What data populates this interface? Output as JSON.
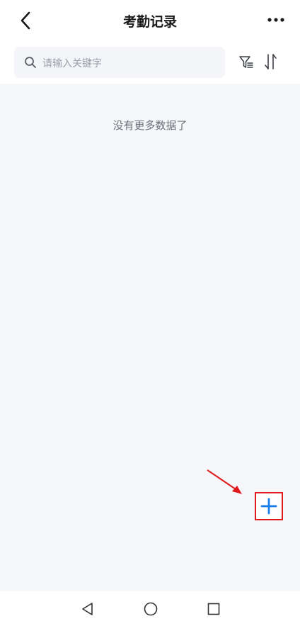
{
  "header": {
    "title": "考勤记录",
    "back_icon": "chevron-left-icon",
    "more_icon": "more-horizontal-icon"
  },
  "search": {
    "placeholder": "请输入关键字",
    "icon": "search-icon"
  },
  "toolbar": {
    "filter_icon": "filter-icon",
    "sort_icon": "sort-icon"
  },
  "content": {
    "empty_message": "没有更多数据了"
  },
  "fab": {
    "icon": "plus-icon",
    "accent_color": "#1a7ee8",
    "highlight_color": "#e01b1b"
  },
  "nav": {
    "back_icon": "triangle-back-icon",
    "home_icon": "circle-home-icon",
    "recent_icon": "square-recent-icon"
  },
  "colors": {
    "content_background": "#f6f7fb",
    "search_background": "#f3f5f9"
  }
}
